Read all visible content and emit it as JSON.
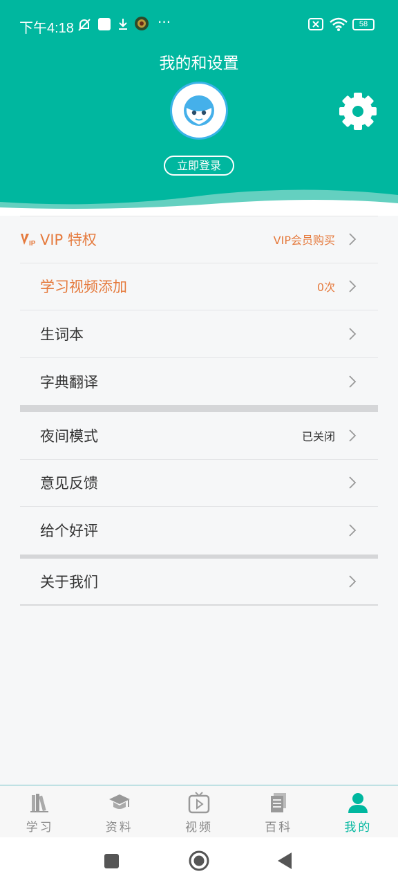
{
  "status": {
    "time": "下午4:18",
    "battery": "58"
  },
  "header": {
    "title": "我的和设置",
    "login_label": "立即登录"
  },
  "menu": {
    "vip": {
      "label": "VIP 特权",
      "value": "VIP会员购买"
    },
    "video_add": {
      "label": "学习视频添加",
      "value": "0次"
    },
    "vocab": {
      "label": "生词本"
    },
    "dictionary": {
      "label": "字典翻译"
    },
    "night_mode": {
      "label": "夜间模式",
      "value": "已关闭"
    },
    "feedback": {
      "label": "意见反馈"
    },
    "rate": {
      "label": "给个好评"
    },
    "about": {
      "label": "关于我们"
    }
  },
  "tabs": [
    {
      "label": "学习",
      "icon": "books-icon"
    },
    {
      "label": "资料",
      "icon": "graduation-cap-icon"
    },
    {
      "label": "视频",
      "icon": "tv-play-icon"
    },
    {
      "label": "百科",
      "icon": "documents-icon"
    },
    {
      "label": "我的",
      "icon": "person-icon",
      "active": true
    }
  ],
  "colors": {
    "accent": "#00b79f",
    "orange": "#e57a3d",
    "avatar_ring": "#3bb3e8"
  }
}
